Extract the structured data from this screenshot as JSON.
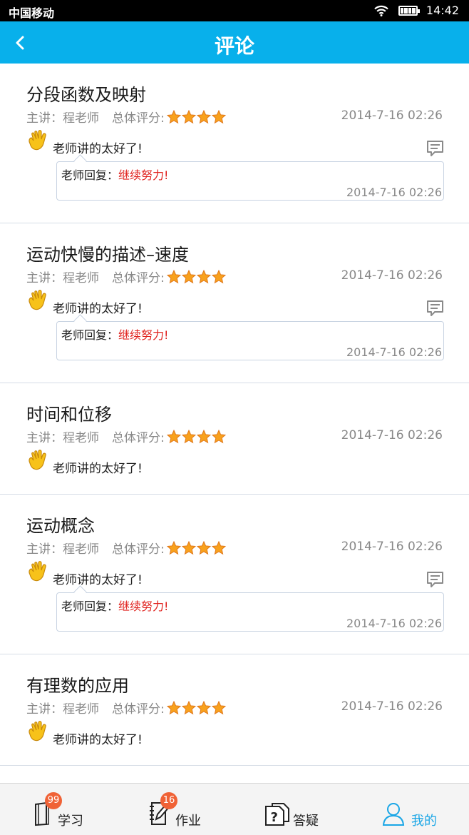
{
  "status_bar": {
    "carrier": "中国移动",
    "time": "14:42",
    "icons": [
      "wifi-icon",
      "battery-icon"
    ]
  },
  "header": {
    "title": "评论",
    "back_icon": "chevron-left-icon",
    "background_color": "#08b0eb"
  },
  "comments": [
    {
      "title": "分段函数及映射",
      "teacher": "主讲：程老师",
      "rating_label": "总体评分:",
      "stars": 4,
      "date": "2014-7-16  02:26",
      "comment": "老师讲的太好了!",
      "has_reply": true,
      "reply_label": "老师回复：",
      "reply_text": "继续努力!",
      "reply_date": "2014-7-16  02:26"
    },
    {
      "title": "运动快慢的描述–速度",
      "teacher": "主讲：程老师",
      "rating_label": "总体评分:",
      "stars": 4,
      "date": "2014-7-16  02:26",
      "comment": "老师讲的太好了!",
      "has_reply": true,
      "reply_label": "老师回复：",
      "reply_text": "继续努力!",
      "reply_date": "2014-7-16  02:26"
    },
    {
      "title": "时间和位移",
      "teacher": "主讲：程老师",
      "rating_label": "总体评分:",
      "stars": 4,
      "date": "2014-7-16  02:26",
      "comment": "老师讲的太好了!",
      "has_reply": false
    },
    {
      "title": "运动概念",
      "teacher": "主讲：程老师",
      "rating_label": "总体评分:",
      "stars": 4,
      "date": "2014-7-16  02:26",
      "comment": "老师讲的太好了!",
      "has_reply": true,
      "reply_label": "老师回复：",
      "reply_text": "继续努力!",
      "reply_date": "2014-7-16  02:26"
    },
    {
      "title": "有理数的应用",
      "teacher": "主讲：程老师",
      "rating_label": "总体评分:",
      "stars": 4,
      "date": "2014-7-16  02:26",
      "comment": "老师讲的太好了!",
      "has_reply": false
    }
  ],
  "bottom_nav": {
    "tabs": [
      {
        "label": "学习",
        "icon": "book-icon",
        "badge": "99",
        "active": false
      },
      {
        "label": "作业",
        "icon": "notebook-icon",
        "badge": "16",
        "active": false
      },
      {
        "label": "答疑",
        "icon": "question-icon",
        "badge": "",
        "active": false
      },
      {
        "label": "我的",
        "icon": "user-icon",
        "badge": "",
        "active": true
      }
    ]
  },
  "colors": {
    "accent": "#08b0eb",
    "reply_text": "#e0231f",
    "badge": "#f06236",
    "active_tab": "#1aa6e6",
    "star": "#f8a11d"
  }
}
